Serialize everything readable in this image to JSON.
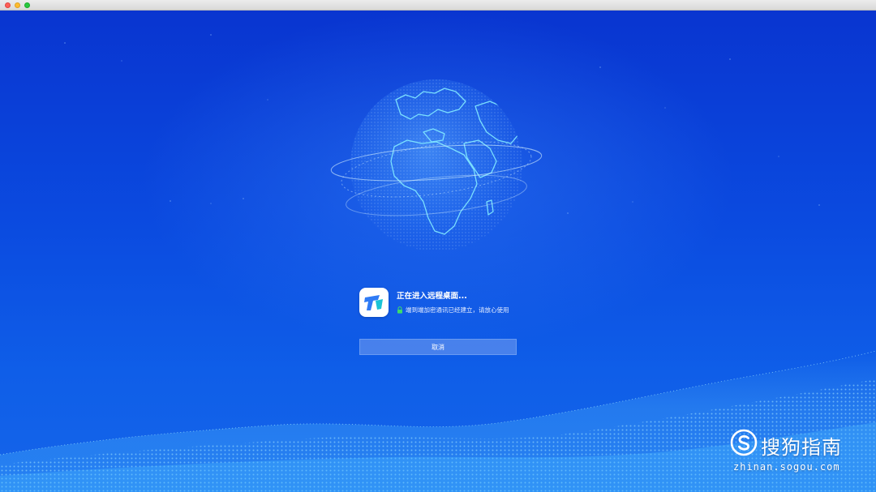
{
  "window": {
    "controls": {
      "close_color": "#fe5f57",
      "minimize_color": "#febc2e",
      "zoom_color": "#28c840"
    }
  },
  "background": {
    "icon": "globe-with-orbits",
    "base_color": "#0b3fd0",
    "globe_line_color": "#7fe6ff",
    "wave_color": "#4ec3ff"
  },
  "connection": {
    "app_icon": "remote-desktop-app-icon",
    "title": "正在进入远程桌面...",
    "security_icon": "lock-icon",
    "security_color": "#3ddc6a",
    "security_text": "端到端加密通讯已经建立，请放心使用"
  },
  "actions": {
    "cancel_label": "取消"
  },
  "watermark": {
    "brand": "搜狗指南",
    "url": "zhinan.sogou.com"
  }
}
